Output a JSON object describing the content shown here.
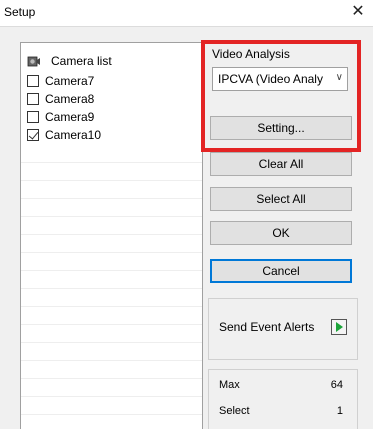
{
  "window": {
    "title": "Setup",
    "close_symbol": "✕"
  },
  "camera_list": {
    "header_label": "Camera list",
    "header_icon": "camera-icon",
    "items": [
      {
        "label": "Camera7",
        "checked": false
      },
      {
        "label": "Camera8",
        "checked": false
      },
      {
        "label": "Camera9",
        "checked": false
      },
      {
        "label": "Camera10",
        "checked": true
      }
    ]
  },
  "video_analysis": {
    "label": "Video Analysis",
    "selected": "IPCVA (Video Analy",
    "highlight_color": "#e32424"
  },
  "buttons": {
    "setting": "Setting...",
    "clear_all": "Clear All",
    "select_all": "Select All",
    "ok": "OK",
    "cancel": "Cancel"
  },
  "alerts": {
    "label": "Send Event Alerts",
    "icon": "play-arrow-icon",
    "icon_color": "#1ca43a"
  },
  "stats": {
    "max_label": "Max",
    "max_value": "64",
    "select_label": "Select",
    "select_value": "1"
  }
}
